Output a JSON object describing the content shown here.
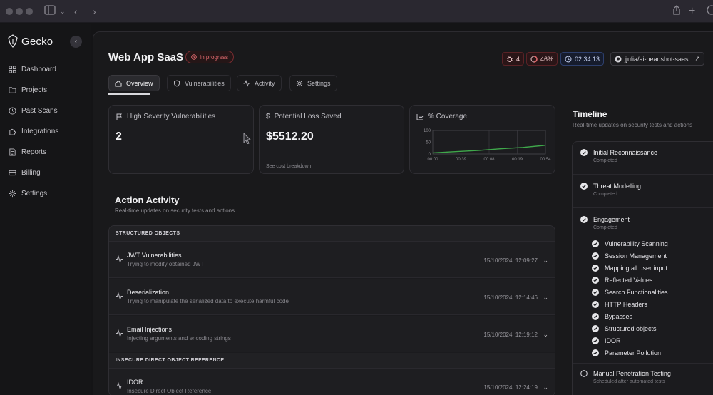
{
  "sidebar": {
    "app_name": "Gecko",
    "items": [
      {
        "label": "Dashboard",
        "icon": "grid-icon"
      },
      {
        "label": "Projects",
        "icon": "folder-icon"
      },
      {
        "label": "Past Scans",
        "icon": "clock-icon"
      },
      {
        "label": "Integrations",
        "icon": "puzzle-icon"
      },
      {
        "label": "Reports",
        "icon": "document-icon"
      },
      {
        "label": "Billing",
        "icon": "credit-card-icon"
      },
      {
        "label": "Settings",
        "icon": "gear-icon"
      }
    ]
  },
  "header": {
    "title": "Web App SaaS",
    "status": "In progress",
    "bug_count": "4",
    "progress": "46%",
    "timer": "02:34:13",
    "repo": "jjulia/ai-headshot-saas"
  },
  "tabs": [
    {
      "label": "Overview",
      "active": true
    },
    {
      "label": "Vulnerabilities",
      "active": false
    },
    {
      "label": "Activity",
      "active": false
    },
    {
      "label": "Settings",
      "active": false
    }
  ],
  "cards": {
    "severity": {
      "label": "High Severity Vulnerabilities",
      "value": "2"
    },
    "loss": {
      "label": "Potential Loss Saved",
      "value": "$5512.20",
      "note": "See cost breakdown"
    },
    "coverage": {
      "label": "% Coverage"
    }
  },
  "chart_data": {
    "type": "line",
    "title": "",
    "x": [
      "00:00",
      "00:39",
      "00:08",
      "00:19",
      "00:54"
    ],
    "y_ticks": [
      "100",
      "50",
      "0"
    ],
    "ylim": [
      0,
      100
    ],
    "series": [
      {
        "values": [
          5,
          10,
          15,
          22,
          28,
          37
        ]
      }
    ],
    "grid": true,
    "line_color": "#3fa84b"
  },
  "activity": {
    "title": "Action Activity",
    "subtitle": "Real-time updates on security tests and actions",
    "groups": [
      {
        "header": "STRUCTURED OBJECTS",
        "items": [
          {
            "title": "JWT Vulnerabilities",
            "desc": "Trying to modify obtained JWT",
            "time": "15/10/2024, 12:09:27"
          },
          {
            "title": "Deserialization",
            "desc": "Trying to manipulate the serialized data to execute harmful code",
            "time": "15/10/2024, 12:14:46"
          },
          {
            "title": "Email Injections",
            "desc": "Injecting arguments and encoding strings",
            "time": "15/10/2024, 12:19:12"
          }
        ]
      },
      {
        "header": "INSECURE DIRECT OBJECT REFERENCE",
        "items": [
          {
            "title": "IDOR",
            "desc": "Insecure Direct Object Reference",
            "time": "15/10/2024, 12:24:19"
          }
        ]
      }
    ]
  },
  "timeline": {
    "title": "Timeline",
    "subtitle": "Real-time updates on security tests and actions",
    "steps": [
      {
        "title": "Initial Reconnaissance",
        "status": "Completed"
      },
      {
        "title": "Threat Modelling",
        "status": "Completed"
      },
      {
        "title": "Engagement",
        "status": "Completed"
      },
      {
        "title": "Manual Penetration Testing",
        "status": "Scheduled after automated tests"
      }
    ],
    "sub_steps": [
      "Vulnerability Scanning",
      "Session Management",
      "Mapping all user input",
      "Reflected Values",
      "Search Functionalities",
      "HTTP Headers",
      "Bypasses",
      "Structured objects",
      "IDOR",
      "Parameter Pollution"
    ]
  }
}
